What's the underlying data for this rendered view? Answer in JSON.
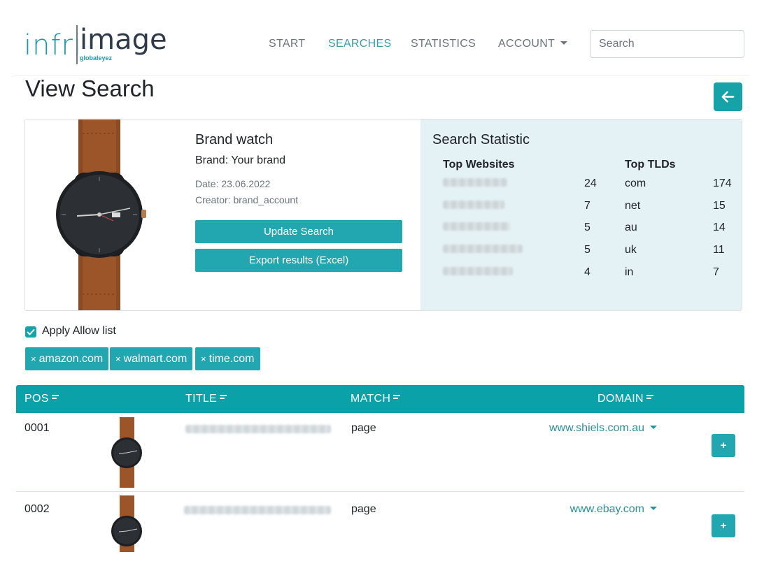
{
  "logo": {
    "part1": "infri",
    "part2": "image",
    "sub": "globaleyez"
  },
  "nav": {
    "items": [
      {
        "label": "START",
        "active": false
      },
      {
        "label": "SEARCHES",
        "active": true
      },
      {
        "label": "STATISTICS",
        "active": false
      },
      {
        "label": "ACCOUNT",
        "active": false,
        "dropdown": true
      }
    ],
    "search_placeholder": "Search"
  },
  "page": {
    "title": "View Search",
    "back_icon": "arrow-left-icon"
  },
  "search": {
    "name": "Brand watch",
    "brand_label": "Brand:",
    "brand_value": "Your brand",
    "date": "Date: 23.06.2022",
    "creator": "Creator: brand_account",
    "update_label": "Update Search",
    "export_label": "Export results (Excel)"
  },
  "statistic": {
    "title": "Search Statistic",
    "websites_header": "Top Websites",
    "tlds_header": "Top TLDs",
    "websites": [
      {
        "count": "24"
      },
      {
        "count": "7"
      },
      {
        "count": "5"
      },
      {
        "count": "5"
      },
      {
        "count": "4"
      }
    ],
    "tlds": [
      {
        "tld": "com",
        "count": "174"
      },
      {
        "tld": "net",
        "count": "15"
      },
      {
        "tld": "au",
        "count": "14"
      },
      {
        "tld": "uk",
        "count": "11"
      },
      {
        "tld": "in",
        "count": "7"
      }
    ]
  },
  "allow_list": {
    "label": "Apply Allow list",
    "checked": true,
    "tags": [
      "amazon.com",
      "walmart.com",
      "time.com"
    ],
    "remove_glyph": "×"
  },
  "table": {
    "headers": {
      "pos": "POS",
      "title": "TITLE",
      "match": "MATCH",
      "domain": "DOMAIN"
    },
    "rows": [
      {
        "pos": "0001",
        "match": "page",
        "domain": "www.shiels.com.au",
        "action": "+"
      },
      {
        "pos": "0002",
        "match": "page",
        "domain": "www.ebay.com",
        "action": "+"
      }
    ]
  },
  "colors": {
    "accent": "#22a6b0",
    "header": "#0aa1a9",
    "stats_bg": "#e4f2f6",
    "link": "#2c8f99"
  }
}
